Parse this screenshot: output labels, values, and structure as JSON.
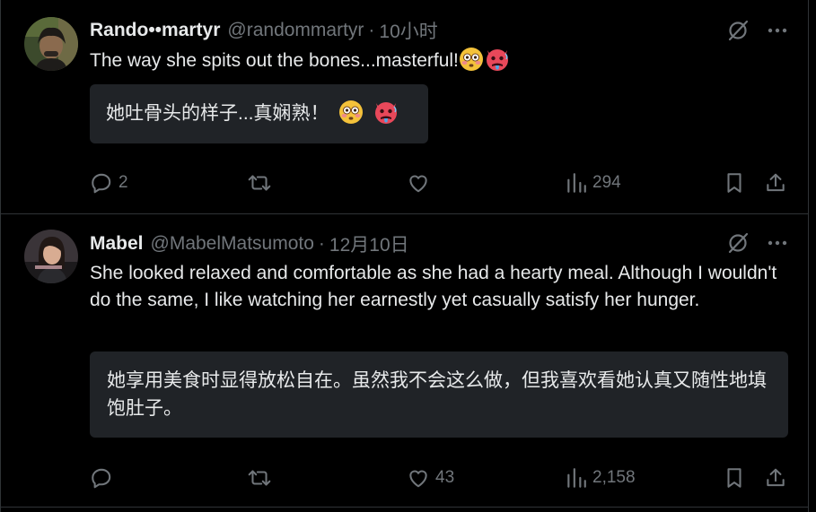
{
  "tweets": [
    {
      "display_name": "Rando••martyr",
      "handle": "@randommartyr",
      "separator": "·",
      "time": "10小时",
      "text": "The way she spits out the bones...masterful!",
      "translation": "她吐骨头的样子...真娴熟！",
      "emojis": [
        "flushed-face-emoji",
        "hot-devil-face-emoji"
      ],
      "replies": "2",
      "reposts": "",
      "likes": "",
      "views": "294"
    },
    {
      "display_name": "Mabel",
      "handle": "@MabelMatsumoto",
      "separator": "·",
      "time": "12月10日",
      "text": "She looked relaxed and comfortable as she had a hearty meal. Although I wouldn't do the same, I like watching her earnestly yet casually satisfy her hunger.",
      "translation": "她享用美食时显得放松自在。虽然我不会这么做，但我喜欢看她认真又随性地填饱肚子。",
      "replies": "",
      "reposts": "",
      "likes": "43",
      "views": "2,158"
    }
  ],
  "colors": {
    "background": "#000000",
    "text": "#e7e9ea",
    "secondary": "#71767b",
    "divider": "#2f3336",
    "translation_bg": "#202327"
  },
  "icons": [
    "grok-icon",
    "more-icon",
    "reply-icon",
    "repost-icon",
    "like-icon",
    "views-icon",
    "bookmark-icon",
    "share-icon"
  ]
}
